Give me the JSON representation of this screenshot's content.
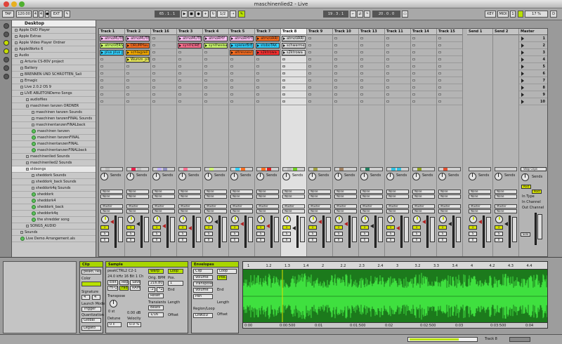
{
  "window": {
    "title": "maschinenlied2 - Live"
  },
  "toolbar": {
    "tap": "TAP",
    "tempo": "120.00",
    "signature_num": "4",
    "signature_den": "4",
    "ext": "EXT",
    "arr_position": "65 .  1 .  1",
    "loop_start": "1 .  1 .  1",
    "quantize": "1/2",
    "loop_length": "19 .  3 .  1",
    "punch_length": "20 .  0 .  0",
    "key": "KEY",
    "midi": "MIDI",
    "overload": "1",
    "cpu": "17 %",
    "d_indicator": "D"
  },
  "browser": {
    "header": "Desktop",
    "items": [
      {
        "label": "Apple DVD Player",
        "indent": 0
      },
      {
        "label": "Apple Extras",
        "indent": 0
      },
      {
        "label": "Apple Video Player Ordner",
        "indent": 0
      },
      {
        "label": "AppleWorks 6",
        "indent": 0
      },
      {
        "label": "Audio",
        "indent": 0
      },
      {
        "label": "Arturia CS-80V project",
        "indent": 1
      },
      {
        "label": "Battery",
        "indent": 1
      },
      {
        "label": "BRENNEN UND SCHROTTEN_Sali",
        "indent": 1
      },
      {
        "label": "Emagic",
        "indent": 1
      },
      {
        "label": "Live 2.0.2 OS 9",
        "indent": 1
      },
      {
        "label": "LIVE ABLETONDemo Songs",
        "indent": 1
      },
      {
        "label": "audiofiles",
        "indent": 2
      },
      {
        "label": "maschinen tanzen ORDNER",
        "indent": 2
      },
      {
        "label": "maschinen tanzen Sounds",
        "indent": 3
      },
      {
        "label": "maschinen tanzenFINAL Sounds",
        "indent": 3
      },
      {
        "label": "maschinentanzenFINALback",
        "indent": 3
      },
      {
        "label": "maschinen tanzen",
        "indent": 3,
        "als": true
      },
      {
        "label": "maschinen tanzenFINAL",
        "indent": 3,
        "als": true
      },
      {
        "label": "maschinentanzenFINAL",
        "indent": 3,
        "als": true
      },
      {
        "label": "maschinentanzenFINALback",
        "indent": 3,
        "als": true
      },
      {
        "label": "maschinenlied Sounds",
        "indent": 2
      },
      {
        "label": "maschinenlied2 Sounds",
        "indent": 2
      },
      {
        "label": "oldsongs",
        "indent": 2,
        "selected": true
      },
      {
        "label": "sheddork Sounds",
        "indent": 3
      },
      {
        "label": "sheddork_back Sounds",
        "indent": 3
      },
      {
        "label": "sheddork4q Sounds",
        "indent": 3
      },
      {
        "label": "sheddork",
        "indent": 3,
        "als": true
      },
      {
        "label": "sheddork4",
        "indent": 3,
        "als": true
      },
      {
        "label": "sheddork_back",
        "indent": 3,
        "als": true
      },
      {
        "label": "sheddork4q",
        "indent": 3,
        "als": true
      },
      {
        "label": "the shredder song",
        "indent": 3,
        "als": true
      },
      {
        "label": "SONGS_AUDIO",
        "indent": 2
      },
      {
        "label": "Sounds",
        "indent": 1
      },
      {
        "label": "Live Demo Arrangement.als",
        "indent": 1,
        "als": true
      }
    ]
  },
  "session": {
    "tracks": [
      {
        "name": "Track 1",
        "clips": [
          {
            "row": 0,
            "label": "atmoMUTE",
            "color": "#ffbff2"
          },
          {
            "row": 1,
            "label": "atmoVERSI",
            "color": "#d0ff70"
          },
          {
            "row": 2,
            "label": "plus plus p",
            "color": "#30d0ff"
          }
        ],
        "colors": [
          "#bbbbbb"
        ],
        "sel": false
      },
      {
        "name": "Track 2",
        "clips": [
          {
            "row": 0,
            "label": "atmoMUTE",
            "color": "#ffbff2"
          },
          {
            "row": 1,
            "label": "DRUMHau",
            "color": "#ff6f20"
          },
          {
            "row": 2,
            "label": "schlagzeil",
            "color": "#ffb000"
          },
          {
            "row": 3,
            "label": "Wumm_pit",
            "color": "#e8e85a"
          }
        ],
        "colors": [
          "#e8204a",
          "#bbbbbb"
        ],
        "sel": false
      },
      {
        "name": "Track 16",
        "clips": [],
        "colors": [
          "#c0b0ff",
          "#9090c0"
        ],
        "sel": false
      },
      {
        "name": "Track 3",
        "clips": [
          {
            "row": 0,
            "label": "atmoMUTE",
            "color": "#ffbff2"
          },
          {
            "row": 1,
            "label": "synthDRE",
            "color": "#ff7090"
          }
        ],
        "colors": [
          "#ff7090"
        ],
        "sel": false
      },
      {
        "name": "Track 4",
        "clips": [
          {
            "row": 0,
            "label": "atmoRHY",
            "color": "#ffbff2"
          },
          {
            "row": 1,
            "label": "synthesisa",
            "color": "#d0ff70"
          }
        ],
        "colors": [
          "#d0ff70"
        ],
        "sel": false
      },
      {
        "name": "Track 5",
        "clips": [
          {
            "row": 0,
            "label": "atmoRHYT",
            "color": "#ffbff2"
          },
          {
            "row": 1,
            "label": "spielerBrE",
            "color": "#30d0ff"
          },
          {
            "row": 2,
            "label": "attrevsevi",
            "color": "#ff6f20"
          }
        ],
        "colors": [
          "#30d0ff",
          "#ff6f20"
        ],
        "sel": false
      },
      {
        "name": "Track 7",
        "clips": [
          {
            "row": 0,
            "label": "atmoVARI",
            "color": "#ff6f20"
          },
          {
            "row": 1,
            "label": "stoboTAK",
            "color": "#30d0ff"
          },
          {
            "row": 2,
            "label": "s2ktrowa",
            "color": "#ff3030"
          }
        ],
        "colors": [
          "#ff6f20",
          "#e02020"
        ],
        "sel": false
      },
      {
        "name": "Track 8",
        "clips": [
          {
            "row": 0,
            "label": "atmoVARI",
            "color": "#dddddd"
          },
          {
            "row": 1,
            "label": "schwerme",
            "color": "#dddddd"
          },
          {
            "row": 2,
            "label": "s2ktrowa",
            "color": "#dddddd"
          }
        ],
        "colors": [
          "#bbbbbb",
          "#70d020"
        ],
        "sel": true
      },
      {
        "name": "Track 9",
        "clips": [],
        "colors": [
          "#a0a040"
        ],
        "sel": false
      },
      {
        "name": "Track 10",
        "clips": [],
        "colors": [
          "#a08060"
        ],
        "sel": false
      },
      {
        "name": "Track 13",
        "clips": [],
        "colors": [
          "#208060"
        ],
        "sel": false
      },
      {
        "name": "Track 11",
        "clips": [],
        "colors": [
          "#30c0e0",
          "#30c0e0"
        ],
        "sel": false
      },
      {
        "name": "Track 14",
        "clips": [],
        "colors": [
          "#8fa020"
        ],
        "sel": false
      },
      {
        "name": "Track 15",
        "clips": [],
        "colors": [
          "#e05030"
        ],
        "sel": false
      }
    ],
    "returns": [
      {
        "name": "Send 1"
      },
      {
        "name": "Send 2"
      }
    ],
    "master": {
      "name": "Master",
      "scenes": [
        "1",
        "2",
        "3",
        "4",
        "5",
        "6",
        "7",
        "8",
        "9",
        "10"
      ],
      "stop_clips": "Stop Clips",
      "post": "Post",
      "in_type": "In Type",
      "in_channel": "In Channel",
      "out_channel": "Out Channel",
      "solo": "Solo"
    },
    "mixer": {
      "sends_label": "Sends",
      "route_none": "None",
      "route_master": "Master",
      "activator": "1",
      "solo": "S",
      "arm": "0"
    }
  },
  "clipview": {
    "clip_title": "Clip",
    "clip_name": "peakCTRL2",
    "color_label": "Color",
    "edit": "Edit",
    "rep": "Rep",
    "save": "Save",
    "hiq": "Hi-Q",
    "fade": "Fade",
    "ram": "RAM",
    "signature_label": "Signature",
    "sig_num": "4",
    "sig_den": "4",
    "launch_mode_label": "Launch Mode",
    "launch_mode": "Trigger",
    "quantization_label": "Quantization",
    "quantization": "Global",
    "legato": "Legato",
    "sample_title": "Sample",
    "sample_name": "peakCTRL2 C2-1",
    "sample_info": "24.0 kHz 16 Bit 1 Ch",
    "warp": "Warp",
    "loop": "Loop",
    "orig_bpm_label": "Orig. BPM",
    "pos_label": "Pos.",
    "orig_bpm": "216.80",
    "pos_val": "1",
    "div": ":2",
    "mul": "*2",
    "reset": "Reset",
    "transpose_label": "Transpose",
    "transients_label": "Transients",
    "length_label": "Length",
    "beats": "Beats",
    "offset_label": "Offset",
    "transient_val": "1/16",
    "transpose_val": "0 st",
    "volume_val": "0.00 dB",
    "detune_label": "Detune",
    "detune_val": "0 c",
    "velocity_label": "Velocity",
    "velocity_val": "0.0 %",
    "env_title": "Envelopes",
    "env_clip": "Clip",
    "env_loop": "Loop",
    "env_volume": "Volume",
    "env_pos": "Pos.",
    "env_transpose": "Transpose",
    "env_vol_btn": "Volume",
    "env_pan": "Pan",
    "env_end": "End",
    "env_length": "Length",
    "region_loop": "Region/Loop",
    "env_offset": "Offset",
    "linked": "LINKED"
  },
  "wave": {
    "bar_ticks": [
      "1",
      "1.2",
      "1.3",
      "1.4",
      "2",
      "2.2",
      "2.3",
      "2.4",
      "3",
      "3.2",
      "3.3",
      "3.4",
      "4",
      "4.2",
      "4.3",
      "4.4"
    ],
    "time_ticks": [
      "0:00",
      "0:00:500",
      "0:01",
      "0:01:500",
      "0:02",
      "0:02:500",
      "0:03",
      "0:03:500",
      "0:04"
    ]
  },
  "status": {
    "track": "Track 8"
  }
}
